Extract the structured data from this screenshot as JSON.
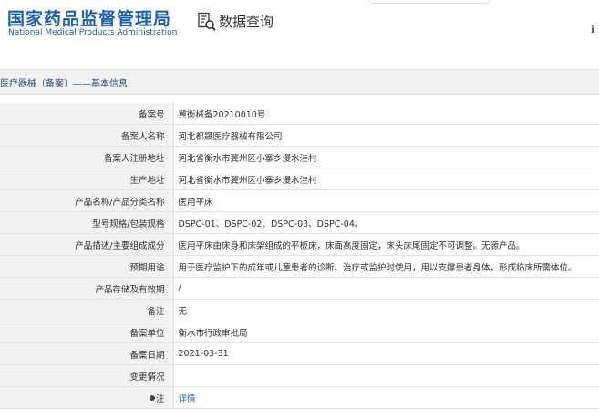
{
  "header": {
    "logo_cn": "国家药品监督管理局",
    "logo_en": "National Medical Products Administration",
    "query_label": "数据查询",
    "right_glyph": "ℹ"
  },
  "breadcrumb": "医疗器械（备案）——基本信息",
  "rows": [
    {
      "label": "备案号",
      "value": "冀衡械备20210010号"
    },
    {
      "label": "备案人名称",
      "value": "河北都晟医疗器械有限公司"
    },
    {
      "label": "备案人注册地址",
      "value": "河北省衡水市冀州区小寨乡漫水洼村"
    },
    {
      "label": "生产地址",
      "value": "河北省衡水市冀州区小寨乡漫水洼村"
    },
    {
      "label": "产品名称/产品分类名称",
      "value": "医用平床"
    },
    {
      "label": "型号规格/包装规格",
      "value": "DSPC-01、DSPC-02、DSPC-03、DSPC-04。"
    },
    {
      "label": "产品描述/主要组成成分",
      "value": "医用平床由床身和床架组成的平板床，床面高度固定，床头床尾固定不可调整。无源产品。"
    },
    {
      "label": "预期用途",
      "value": "用于医疗监护下的成年或儿童患者的诊断、治疗或监护时使用，用以支撑患者身体，形成临床所需体位。"
    },
    {
      "label": "产品存储及有效期",
      "value": "/"
    },
    {
      "label": "备注",
      "value": "无"
    },
    {
      "label": "备案单位",
      "value": "衡水市行政审批局"
    },
    {
      "label": "备案日期",
      "value": "2021-03-31"
    },
    {
      "label": "变更情况",
      "value": ""
    },
    {
      "label": "注",
      "value": "详情"
    }
  ],
  "colors": {
    "brand_blue": "#1c5fa8",
    "label_bg": "#f2f2f2",
    "border": "#e3e3e3"
  },
  "icons": {
    "query": "document-search-icon",
    "note": "bullet-icon"
  }
}
